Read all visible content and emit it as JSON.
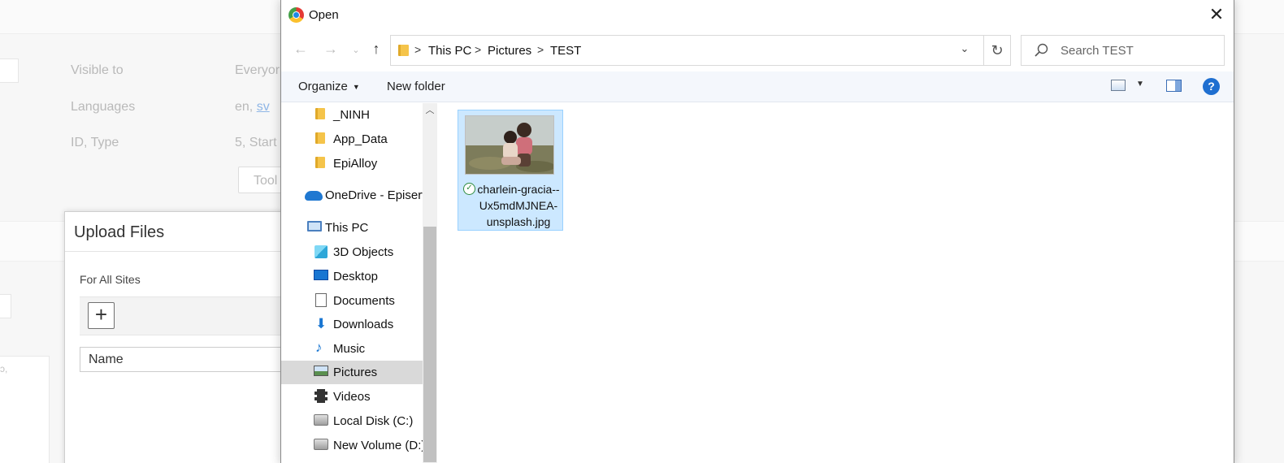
{
  "background": {
    "labels": {
      "visible_to": "Visible to",
      "visible_to_value": "Everyor",
      "languages": "Languages",
      "languages_value_prefix": "en, ",
      "languages_link": "sv",
      "id_type": "ID, Type",
      "id_type_value": "5, Start",
      "tool_button": "Tool"
    },
    "left_glyph": "ɔ,",
    "upload_modal": {
      "title": "Upload Files",
      "subtitle": "For All Sites",
      "add_button": "+",
      "column_name": "Name"
    }
  },
  "dialog": {
    "title": "Open",
    "close": "✕",
    "breadcrumb": [
      "This PC",
      "Pictures",
      "TEST"
    ],
    "search": {
      "placeholder": "Search TEST"
    },
    "toolbar": {
      "organize": "Organize",
      "new_folder": "New folder",
      "help": "?"
    },
    "nav_tree": [
      {
        "label": "_NINH",
        "icon": "folder-icon"
      },
      {
        "label": "App_Data",
        "icon": "folder-icon"
      },
      {
        "label": "EpiAlloy",
        "icon": "folder-icon"
      },
      {
        "label": "OneDrive - Episerv",
        "icon": "onedrive-icon"
      },
      {
        "label": "This PC",
        "icon": "computer-icon"
      },
      {
        "label": "3D Objects",
        "icon": "3d-objects-icon"
      },
      {
        "label": "Desktop",
        "icon": "desktop-icon"
      },
      {
        "label": "Documents",
        "icon": "documents-icon"
      },
      {
        "label": "Downloads",
        "icon": "downloads-icon"
      },
      {
        "label": "Music",
        "icon": "music-icon"
      },
      {
        "label": "Pictures",
        "icon": "pictures-icon",
        "selected": true
      },
      {
        "label": "Videos",
        "icon": "videos-icon"
      },
      {
        "label": "Local Disk (C:)",
        "icon": "local-disk-icon"
      },
      {
        "label": "New Volume (D:)",
        "icon": "drive-icon"
      }
    ],
    "files": [
      {
        "name": "charlein-gracia--Ux5mdMJNEA-unsplash.jpg",
        "status_icon": "sync-check-icon"
      }
    ]
  }
}
